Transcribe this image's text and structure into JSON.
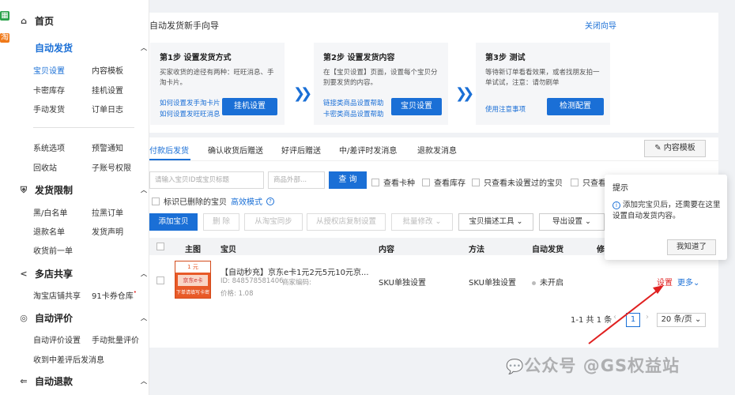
{
  "sidebar": {
    "home": "首页",
    "auto_ship": "自动发货",
    "auto_ship_items": [
      "宝贝设置",
      "内容模板",
      "卡密库存",
      "挂机设置",
      "手动发货",
      "订单日志"
    ],
    "sys_items": [
      "系统选项",
      "预警通知",
      "回收站",
      "子账号权限"
    ],
    "ship_limit": "发货限制",
    "ship_limit_items": [
      "黑/白名单",
      "拉黑订单",
      "退款名单",
      "发货声明",
      "收货前一单"
    ],
    "multi_store": "多店共享",
    "multi_store_items": [
      "淘宝店铺共享",
      "91卡券仓库"
    ],
    "auto_review": "自动评价",
    "auto_review_items": [
      "自动评价设置",
      "手动批量评价",
      "收到中差评后发消息"
    ],
    "auto_refund": "自动退款"
  },
  "guide": {
    "title": "自动发货新手向导",
    "close": "关闭向导",
    "steps": [
      {
        "title": "第1步 设置发货方式",
        "desc": "买家收货的途径有两种：旺旺消息、手淘卡片。",
        "links": [
          "如何设置发手淘卡片",
          "如何设置发旺旺消息"
        ],
        "button": "挂机设置"
      },
      {
        "title": "第2步 设置发货内容",
        "desc": "在【宝贝设置】页面，设置每个宝贝分别要发货的内容。",
        "links": [
          "链接类商品设置帮助",
          "卡密类商品设置帮助"
        ],
        "button": "宝贝设置"
      },
      {
        "title": "第3步 测试",
        "desc": "等待新订单看看效果，或者找朋友拍一单试试，注意：请勿刷单",
        "links": [
          "使用注意事项"
        ],
        "button": "检测配置"
      }
    ]
  },
  "tabs": [
    "付款后发货",
    "确认收货后赠送",
    "好评后赠送",
    "中/差评时发消息",
    "退款发消息"
  ],
  "content_template_btn": "内容模板",
  "filters": {
    "id_placeholder": "请输入宝贝ID或宝贝标题",
    "outer_placeholder": "商品外部...",
    "query": "查 询",
    "checks": [
      "查看卡种",
      "查看库存",
      "只查看未设置过的宝贝",
      "只查看",
      "标识已删除的宝贝"
    ],
    "advanced": "高效模式"
  },
  "toolbar": [
    "添加宝贝",
    "删 除",
    "从淘宝同步",
    "从授权店复制设置",
    "批量修改",
    "宝贝描述工具",
    "导出设置"
  ],
  "table": {
    "headers": [
      "主图",
      "宝贝",
      "内容",
      "方法",
      "自动发货",
      "修"
    ],
    "row": {
      "image_text": [
        "1 元",
        "京东e卡",
        "下单请填写卡密"
      ],
      "title": "【自动秒充】京东e卡1元2元5元10元京...",
      "id": "ID: 848578581406",
      "outer_code": "商家编码:",
      "price": "价格: 1.08",
      "content": "SKU单独设置",
      "method": "SKU单独设置",
      "auto_ship": "未开启",
      "set": "设置",
      "more": "更多"
    }
  },
  "pagination": {
    "summary": "1-1 共 1 条",
    "page": "1",
    "size": "20 条/页"
  },
  "tooltip": {
    "title": "提示",
    "body": "添加完宝贝后，还需要在这里设置自动发货内容。",
    "button": "我知道了"
  },
  "watermark": "公众号 @GS权益站",
  "colors": {
    "accent": "#1a6fd6",
    "arrow": "#e02020"
  }
}
